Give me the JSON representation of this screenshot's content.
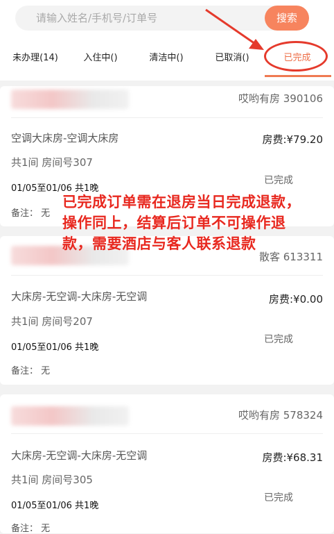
{
  "search": {
    "placeholder": "请输入姓名/手机号/订单号",
    "button_label": "搜索"
  },
  "tabs": [
    {
      "label": "未办理(14)"
    },
    {
      "label": "入住中()"
    },
    {
      "label": "清洁中()"
    },
    {
      "label": "已取消()"
    },
    {
      "label": "已完成"
    }
  ],
  "active_tab": "已完成",
  "orders": [
    {
      "hotel": "哎哟有房 390106",
      "room_type": "空调大床房-空调大床房",
      "fee": "房费:¥79.20",
      "room_info": "共1间 房间号307",
      "dates": "01/05至01/06   共1晚",
      "status": "已完成",
      "remark": "备注：  无"
    },
    {
      "hotel": "散客 613311",
      "room_type": "大床房-无空调-大床房-无空调",
      "fee": "房费:¥0.00",
      "room_info": "共1间 房间号207",
      "dates": "01/05至01/06   共1晚",
      "status": "已完成",
      "remark": "备注：  无"
    },
    {
      "hotel": "哎哟有房 578324",
      "room_type": "大床房-无空调-大床房-无空调",
      "fee": "房费:¥68.31",
      "room_info": "共1间 房间号305",
      "dates": "01/05至01/06   共1晚",
      "status": "已完成",
      "remark": "备注：  无"
    }
  ],
  "annotation": {
    "text": "已完成订单需在退房当日完成退款，操作同上，结算后订单不可操作退款，需要酒店与客人联系退款",
    "color": "#e8281f"
  },
  "colors": {
    "accent": "#f7845e",
    "active_tab": "#ee6e47",
    "highlight_circle": "#e53a2c"
  }
}
